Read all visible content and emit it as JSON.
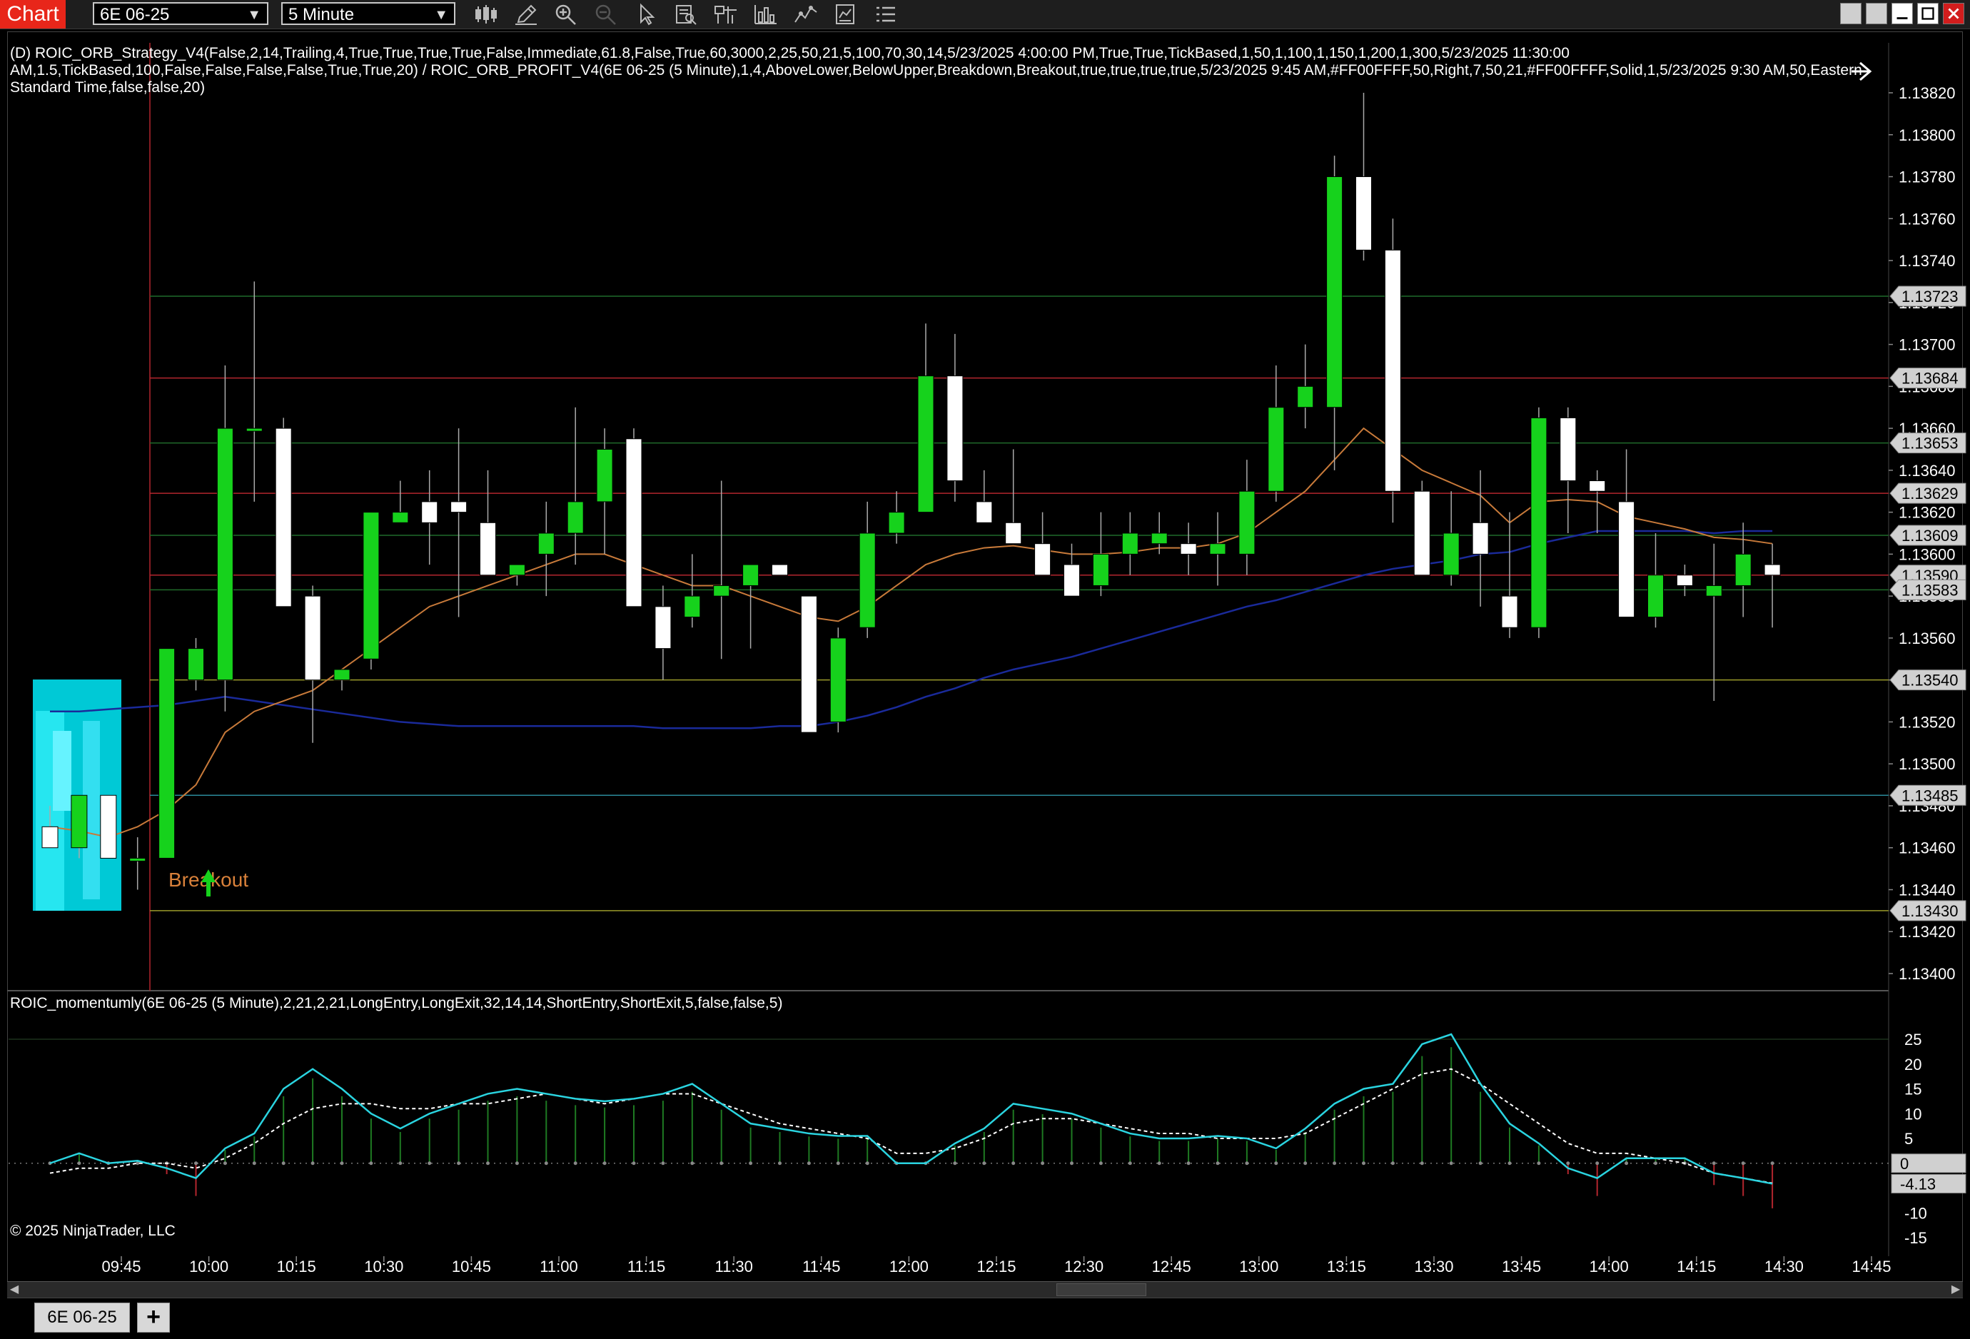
{
  "window": {
    "app_title": "Chart",
    "instrument": "6E 06-25",
    "interval": "5 Minute"
  },
  "toolbar_icons": [
    "bar-type-icon",
    "draw-pencil-icon",
    "zoom-in-icon",
    "zoom-out-icon",
    "pointer-icon",
    "data-box-icon",
    "indicators-icon",
    "strategies-icon",
    "chart-trader-icon",
    "properties-icon",
    "list-icon"
  ],
  "chart": {
    "strategy_label_line1": "(D) ROIC_ORB_Strategy_V4(False,2,14,Trailing,4,True,True,True,True,False,Immediate,61.8,False,True,60,3000,2,25,50,21,5,100,70,30,14,5/23/2025 4:00:00 PM,True,True,TickBased,1,50,1,100,1,150,1,200,1,300,5/23/2025 11:30:00",
    "strategy_label_line2": "AM,1.5,TickBased,100,False,False,False,False,True,True,20) / ROIC_ORB_PROFIT_V4(6E 06-25 (5 Minute),1,4,AboveLower,BelowUpper,Breakdown,Breakout,true,true,true,true,5/23/2025 9:45 AM,#FF00FFFF,50,Right,7,50,21,#FF00FFFF,Solid,1,5/23/2025 9:30 AM,50,Eastern",
    "strategy_label_line3": "Standard Time,false,false,20)",
    "breakout_text": "Breakout",
    "copyright": "© 2025 NinjaTrader, LLC",
    "price_ticks": [
      "1.13820",
      "1.13800",
      "1.13780",
      "1.13760",
      "1.13740",
      "1.13720",
      "1.13700",
      "1.13680",
      "1.13660",
      "1.13640",
      "1.13620",
      "1.13600",
      "1.13580",
      "1.13560",
      "1.13540",
      "1.13520",
      "1.13500",
      "1.13480",
      "1.13460",
      "1.13440",
      "1.13420",
      "1.13400"
    ],
    "price_tags": [
      {
        "label": "1.13723",
        "price": 1.13723,
        "color": "#1f6a2a"
      },
      {
        "label": "1.13684",
        "price": 1.13684,
        "color": "#b3262e"
      },
      {
        "label": "1.13653",
        "price": 1.13653,
        "color": "#1f6a2a"
      },
      {
        "label": "1.13629",
        "price": 1.13629,
        "color": "#b3262e"
      },
      {
        "label": "1.13609",
        "price": 1.13609,
        "color": "#1f6a2a"
      },
      {
        "label": "1.13590",
        "price": 1.1359,
        "color": "#b3262e"
      },
      {
        "label": "1.13583",
        "price": 1.13583,
        "color": "#1f6a2a"
      },
      {
        "label": "1.13540",
        "price": 1.1354,
        "color": "#9a9a2a"
      },
      {
        "label": "1.13485",
        "price": 1.13485,
        "color": "#2a8a9a"
      },
      {
        "label": "1.13430",
        "price": 1.1343,
        "color": "#9a9a2a"
      }
    ],
    "time_ticks": [
      "09:45",
      "10:00",
      "10:15",
      "10:30",
      "10:45",
      "11:00",
      "11:15",
      "11:30",
      "11:45",
      "12:00",
      "12:15",
      "12:30",
      "12:45",
      "13:00",
      "13:15",
      "13:30",
      "13:45",
      "14:00",
      "14:15",
      "14:30",
      "14:45"
    ],
    "candles": [
      [
        1.1347,
        1.1348,
        1.1346,
        1.1346
      ],
      [
        1.1346,
        1.13485,
        1.13455,
        1.13485
      ],
      [
        1.13485,
        1.13485,
        1.13455,
        1.13455
      ],
      [
        1.13455,
        1.13465,
        1.1344,
        1.13455
      ],
      [
        1.13455,
        1.1355,
        1.13455,
        1.13555
      ],
      [
        1.1354,
        1.1356,
        1.13535,
        1.13555
      ],
      [
        1.1354,
        1.1369,
        1.13525,
        1.1366
      ],
      [
        1.1366,
        1.1373,
        1.13625,
        1.1366
      ],
      [
        1.1366,
        1.13665,
        1.13575,
        1.13575
      ],
      [
        1.1358,
        1.13585,
        1.1351,
        1.1354
      ],
      [
        1.1354,
        1.13545,
        1.13535,
        1.13545
      ],
      [
        1.1355,
        1.1362,
        1.13545,
        1.1362
      ],
      [
        1.13615,
        1.13635,
        1.13615,
        1.1362
      ],
      [
        1.13625,
        1.1364,
        1.13595,
        1.13615
      ],
      [
        1.13625,
        1.1366,
        1.1357,
        1.1362
      ],
      [
        1.13615,
        1.1364,
        1.1359,
        1.1359
      ],
      [
        1.1359,
        1.13595,
        1.13585,
        1.13595
      ],
      [
        1.136,
        1.13625,
        1.1358,
        1.1361
      ],
      [
        1.1361,
        1.1367,
        1.13595,
        1.13625
      ],
      [
        1.13625,
        1.1366,
        1.136,
        1.1365
      ],
      [
        1.13655,
        1.1366,
        1.1358,
        1.13575
      ],
      [
        1.13575,
        1.13585,
        1.1354,
        1.13555
      ],
      [
        1.1357,
        1.136,
        1.13565,
        1.1358
      ],
      [
        1.1358,
        1.13635,
        1.1355,
        1.13585
      ],
      [
        1.13585,
        1.13595,
        1.13555,
        1.13595
      ],
      [
        1.13595,
        1.13595,
        1.1359,
        1.1359
      ],
      [
        1.1358,
        1.1358,
        1.13515,
        1.13515
      ],
      [
        1.1352,
        1.13565,
        1.13515,
        1.1356
      ],
      [
        1.13565,
        1.13625,
        1.1356,
        1.1361
      ],
      [
        1.1361,
        1.1363,
        1.13605,
        1.1362
      ],
      [
        1.1362,
        1.1371,
        1.1362,
        1.13685
      ],
      [
        1.13685,
        1.13705,
        1.13625,
        1.13635
      ],
      [
        1.13625,
        1.1364,
        1.13615,
        1.13615
      ],
      [
        1.13615,
        1.1365,
        1.13605,
        1.13605
      ],
      [
        1.13605,
        1.1362,
        1.1359,
        1.1359
      ],
      [
        1.13595,
        1.13605,
        1.1358,
        1.1358
      ],
      [
        1.13585,
        1.1362,
        1.1358,
        1.136
      ],
      [
        1.136,
        1.1362,
        1.1359,
        1.1361
      ],
      [
        1.13605,
        1.1362,
        1.136,
        1.1361
      ],
      [
        1.13605,
        1.13615,
        1.1359,
        1.136
      ],
      [
        1.136,
        1.1362,
        1.13585,
        1.13605
      ],
      [
        1.136,
        1.13645,
        1.1359,
        1.1363
      ],
      [
        1.1363,
        1.1369,
        1.13625,
        1.1367
      ],
      [
        1.1367,
        1.137,
        1.1366,
        1.1368
      ],
      [
        1.1367,
        1.1379,
        1.1364,
        1.1378
      ],
      [
        1.1378,
        1.1382,
        1.1374,
        1.13745
      ],
      [
        1.13745,
        1.1376,
        1.13615,
        1.1363
      ],
      [
        1.1363,
        1.13635,
        1.136,
        1.1359
      ],
      [
        1.1359,
        1.1363,
        1.13585,
        1.1361
      ],
      [
        1.13615,
        1.1364,
        1.13575,
        1.136
      ],
      [
        1.1358,
        1.1362,
        1.1356,
        1.13565
      ],
      [
        1.13565,
        1.1367,
        1.1356,
        1.13665
      ],
      [
        1.13665,
        1.1367,
        1.1361,
        1.13635
      ],
      [
        1.13635,
        1.1364,
        1.1361,
        1.1363
      ],
      [
        1.13625,
        1.1365,
        1.1358,
        1.1357
      ],
      [
        1.1357,
        1.1361,
        1.13565,
        1.1359
      ],
      [
        1.1359,
        1.13595,
        1.1358,
        1.13585
      ],
      [
        1.1358,
        1.13605,
        1.1353,
        1.13585
      ],
      [
        1.13585,
        1.13615,
        1.1357,
        1.136
      ],
      [
        1.13595,
        1.13605,
        1.13565,
        1.1359
      ]
    ],
    "ema_fast": [
      1.1347,
      1.13468,
      1.13465,
      1.1347,
      1.13478,
      1.1349,
      1.13515,
      1.13525,
      1.1353,
      1.13535,
      1.13545,
      1.13555,
      1.13565,
      1.13575,
      1.1358,
      1.13585,
      1.1359,
      1.13595,
      1.136,
      1.136,
      1.13595,
      1.1359,
      1.13585,
      1.13585,
      1.1358,
      1.13575,
      1.1357,
      1.13568,
      1.13575,
      1.13585,
      1.13595,
      1.136,
      1.13603,
      1.13604,
      1.13602,
      1.136,
      1.136,
      1.13601,
      1.13603,
      1.13603,
      1.13605,
      1.1361,
      1.1362,
      1.1363,
      1.13645,
      1.1366,
      1.1365,
      1.1364,
      1.13634,
      1.13628,
      1.13615,
      1.13625,
      1.13626,
      1.13625,
      1.13618,
      1.13615,
      1.13612,
      1.13608,
      1.13607,
      1.13605
    ],
    "ema_slow": [
      1.13525,
      1.13525,
      1.13526,
      1.13527,
      1.13528,
      1.1353,
      1.13532,
      1.1353,
      1.13528,
      1.13526,
      1.13524,
      1.13522,
      1.1352,
      1.13519,
      1.13518,
      1.13518,
      1.13518,
      1.13518,
      1.13518,
      1.13518,
      1.13518,
      1.13517,
      1.13517,
      1.13517,
      1.13517,
      1.13518,
      1.13518,
      1.1352,
      1.13523,
      1.13527,
      1.13532,
      1.13536,
      1.13541,
      1.13545,
      1.13548,
      1.13551,
      1.13555,
      1.13559,
      1.13563,
      1.13567,
      1.13571,
      1.13575,
      1.13578,
      1.13582,
      1.13586,
      1.1359,
      1.13593,
      1.13595,
      1.13597,
      1.136,
      1.13601,
      1.13605,
      1.13608,
      1.13611,
      1.13611,
      1.13611,
      1.13611,
      1.1361,
      1.13611,
      1.13611
    ]
  },
  "oscillator": {
    "label": "ROIC_momentumly(6E 06-25 (5 Minute),2,21,2,21,LongEntry,LongExit,32,14,14,ShortEntry,ShortExit,5,false,false,5)",
    "ticks": [
      "25",
      "20",
      "15",
      "10",
      "5",
      "0",
      "-10",
      "-15"
    ],
    "current_tag": "-4.13",
    "zero_tag": "0",
    "fast": [
      0,
      2,
      0,
      0.5,
      -1,
      -3,
      3,
      6,
      15,
      19,
      15,
      10,
      7,
      10,
      12,
      14,
      15,
      14,
      13,
      12.5,
      13,
      14,
      16,
      12,
      8,
      7,
      6,
      5.5,
      5.5,
      0,
      0,
      4,
      7,
      12,
      11,
      10,
      8,
      6,
      5,
      5,
      5.5,
      5,
      3,
      7,
      12,
      15,
      16,
      24,
      26,
      16,
      8,
      4,
      -1,
      -3,
      1,
      1,
      1,
      -2,
      -3,
      -4.13
    ],
    "slow": [
      -2,
      -1,
      -1,
      0,
      0,
      -1,
      1,
      4,
      8,
      11,
      12,
      12,
      11,
      11,
      12,
      12,
      13,
      14,
      13,
      12,
      13,
      14,
      14,
      12,
      10,
      8,
      7,
      6,
      5,
      2,
      2,
      3,
      5,
      8,
      9,
      9,
      8,
      7,
      6,
      6,
      5,
      5,
      5,
      6,
      9,
      12,
      15,
      18,
      19,
      16,
      12,
      8,
      4,
      2,
      2,
      1,
      0,
      -2,
      -3,
      -4
    ]
  }
}
